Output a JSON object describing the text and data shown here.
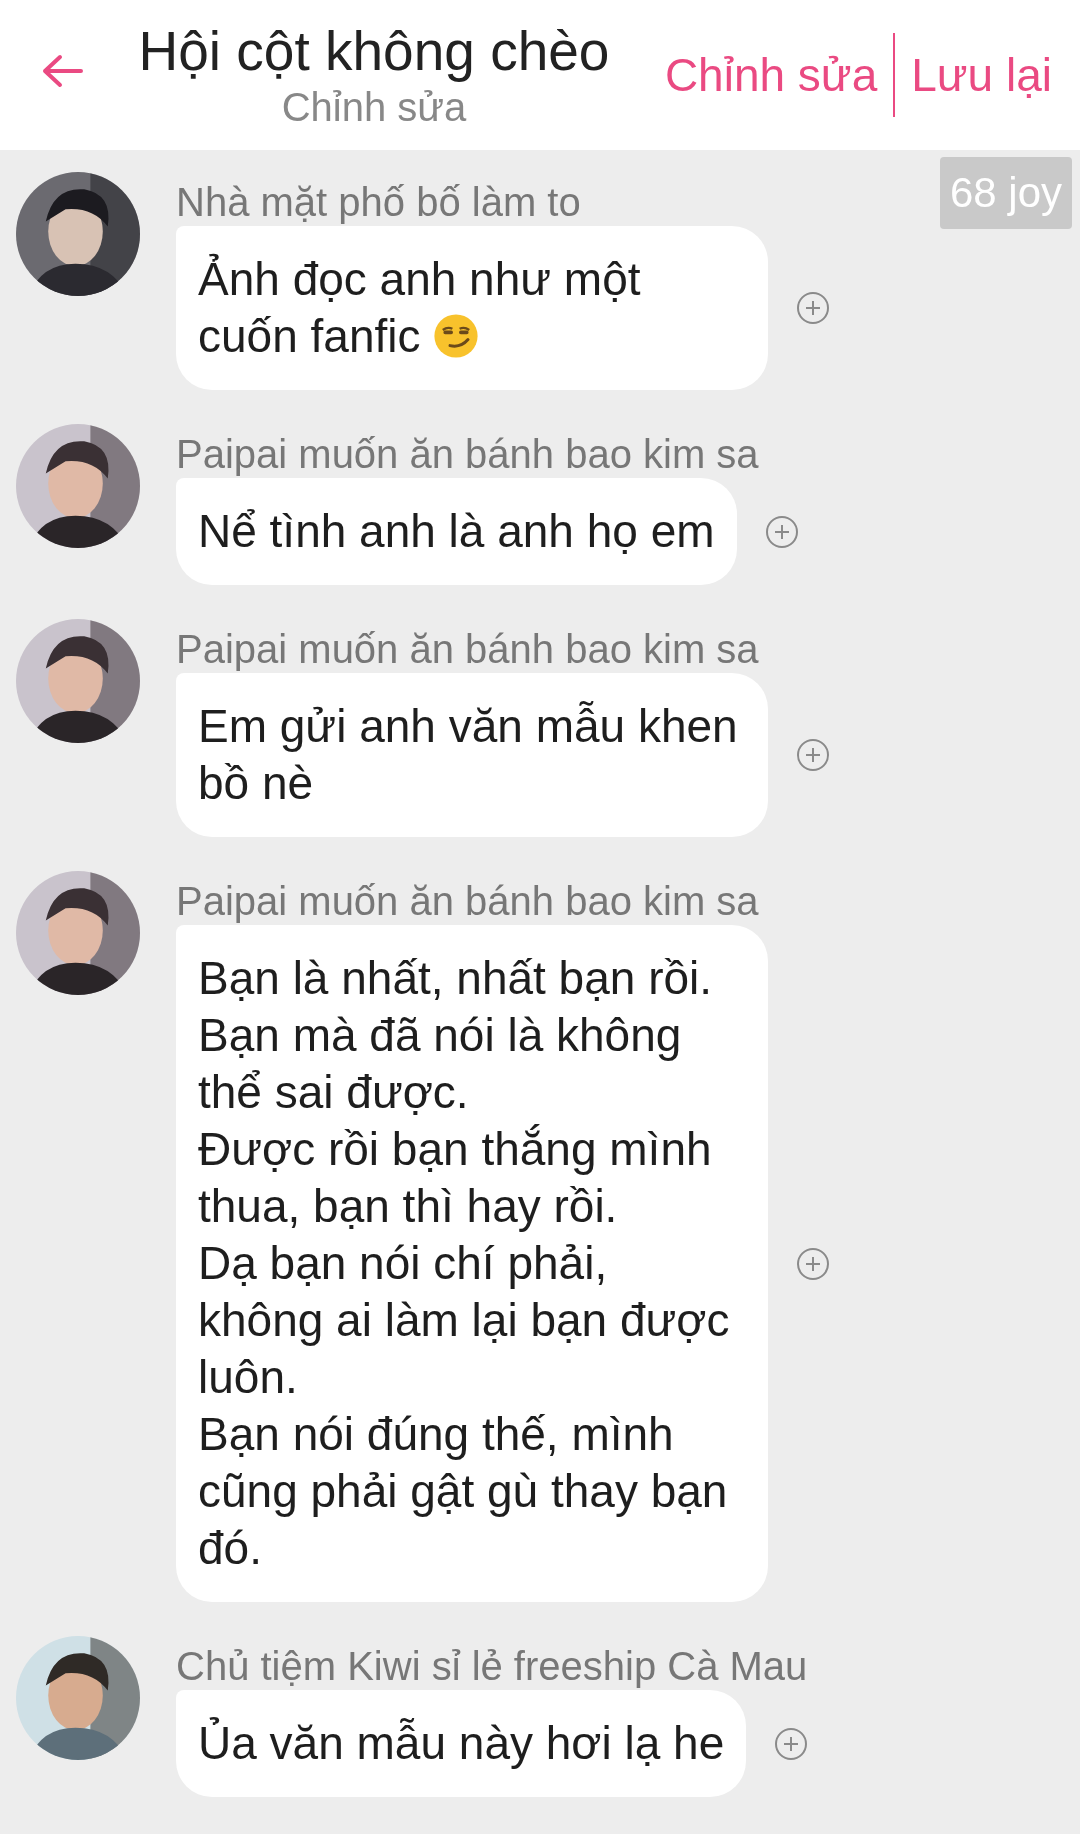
{
  "header": {
    "title": "Hội cột không chèo",
    "subtitle": "Chỉnh sửa",
    "actions": [
      "Chỉnh sửa",
      "Lưu lại"
    ]
  },
  "badge": "68 joy",
  "messages": [
    {
      "sender": "Nhà mặt phố bố làm to",
      "text": "Ảnh đọc anh như một\ncuốn fanfic",
      "emoji": true
    },
    {
      "sender": "Paipai muốn ăn bánh bao kim sa",
      "text": "Nể tình anh là anh họ em",
      "emoji": false
    },
    {
      "sender": "Paipai muốn ăn bánh bao kim sa",
      "text": "Em gửi anh văn mẫu khen\nbồ nè",
      "emoji": false
    },
    {
      "sender": "Paipai muốn ăn bánh bao kim sa",
      "text": "Bạn là nhất, nhất bạn rồi.\nBạn mà đã nói là không\nthể sai được.\nĐược rồi bạn thắng mình\nthua, bạn thì hay rồi.\nDạ bạn nói chí phải,\nkhông ai làm lại bạn được\nluôn.\nBạn nói đúng thế, mình\ncũng phải gật gù thay bạn\nđó.",
      "emoji": false
    },
    {
      "sender": "Chủ tiệm Kiwi sỉ lẻ freeship Cà Mau",
      "text": "Ủa văn mẫu này hơi lạ he",
      "emoji": false
    }
  ]
}
